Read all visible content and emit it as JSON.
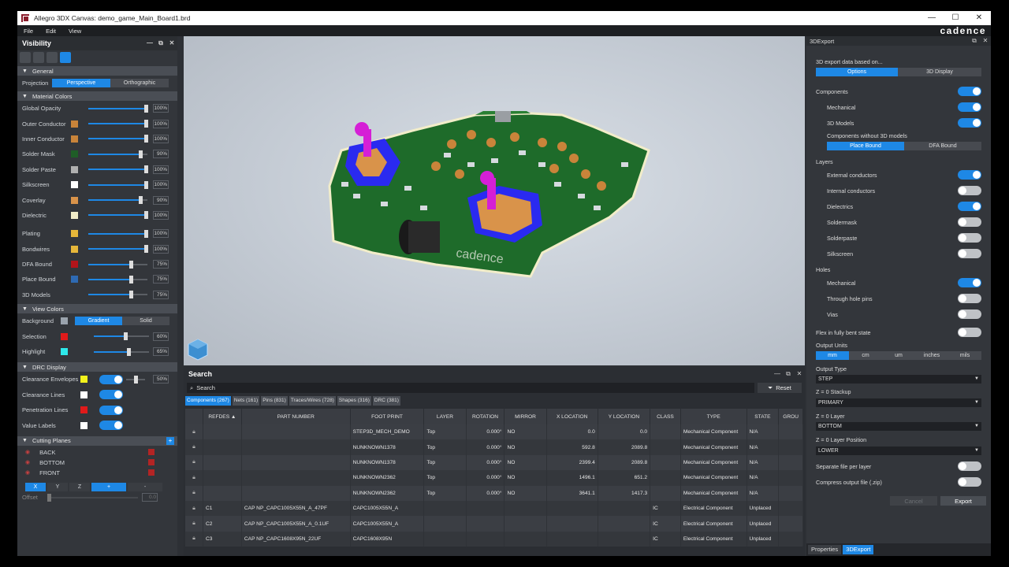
{
  "window": {
    "title": "Allegro 3DX Canvas: demo_game_Main_Board1.brd",
    "minimize": "—",
    "maximize": "☐",
    "close": "✕"
  },
  "menu": {
    "items": [
      "File",
      "Edit",
      "View"
    ],
    "logo": "cadence"
  },
  "visibility": {
    "title": "Visibility",
    "general": {
      "label": "General",
      "projection_label": "Projection",
      "projection_options": [
        "Perspective",
        "Orthographic"
      ]
    },
    "material_colors": {
      "label": "Material Colors",
      "rows": [
        {
          "name": "Global Opacity",
          "swatch": "",
          "value": "100%",
          "pct": 100
        },
        {
          "name": "Outer Conductor",
          "swatch": "#c9843a",
          "value": "100%",
          "pct": 100
        },
        {
          "name": "Inner Conductor",
          "swatch": "#c9843a",
          "value": "100%",
          "pct": 100
        },
        {
          "name": "Solder Mask",
          "swatch": "#1f5d27",
          "value": "90%",
          "pct": 90
        },
        {
          "name": "Solder Paste",
          "swatch": "#b0b0b0",
          "value": "100%",
          "pct": 100
        },
        {
          "name": "Silkscreen",
          "swatch": "#ffffff",
          "value": "100%",
          "pct": 100
        },
        {
          "name": "Coverlay",
          "swatch": "#d9934a",
          "value": "90%",
          "pct": 90
        },
        {
          "name": "Dielectric",
          "swatch": "#f2edc9",
          "value": "100%",
          "pct": 100
        },
        {
          "name": "Plating",
          "swatch": "#e6b73a",
          "value": "100%",
          "pct": 100
        },
        {
          "name": "Bondwires",
          "swatch": "#e6b73a",
          "value": "100%",
          "pct": 100
        },
        {
          "name": "DFA Bound",
          "swatch": "#b3141a",
          "value": "75%",
          "pct": 75
        },
        {
          "name": "Place Bound",
          "swatch": "#2e6ab3",
          "value": "75%",
          "pct": 75
        },
        {
          "name": "3D Models",
          "swatch": "",
          "value": "75%",
          "pct": 75
        }
      ]
    },
    "view_colors": {
      "label": "View Colors",
      "background_label": "Background",
      "background_swatch": "#9aa3ad",
      "background_options": [
        "Gradient",
        "Solid"
      ],
      "selection": {
        "name": "Selection",
        "swatch": "#e01a1a",
        "value": "60%",
        "pct": 60
      },
      "highlight": {
        "name": "Highlight",
        "swatch": "#2ee8ea",
        "value": "65%",
        "pct": 65
      }
    },
    "drc_display": {
      "label": "DRC Display",
      "rows": [
        {
          "name": "Clearance Envelopes",
          "swatch": "#f2f21c",
          "value": "50%"
        },
        {
          "name": "Clearance Lines",
          "swatch": "#ffffff"
        },
        {
          "name": "Penetration Lines",
          "swatch": "#e01a1a"
        },
        {
          "name": "Value Labels",
          "swatch": "#ffffff"
        }
      ]
    },
    "cutting_planes": {
      "label": "Cutting Planes",
      "planes": [
        "BACK",
        "BOTTOM",
        "FRONT"
      ],
      "axis_buttons": [
        "X",
        "Y",
        "Z",
        "+",
        "-"
      ],
      "offset_label": "Offset",
      "offset_value": "0.0"
    }
  },
  "search": {
    "title": "Search",
    "placeholder": "Search",
    "reset_label": "Reset",
    "filters": [
      "Components (267)",
      "Nets (161)",
      "Pins (831)",
      "Traces/Wires (728)",
      "Shapes (316)",
      "DRC (381)"
    ],
    "columns": [
      "REFDES ▲",
      "PART NUMBER",
      "FOOT PRINT",
      "LAYER",
      "ROTATION",
      "MIRROR",
      "X LOCATION",
      "Y LOCATION",
      "CLASS",
      "TYPE",
      "STATE",
      "GROU"
    ],
    "rows": [
      [
        "",
        "",
        "STEP3D_MECH_DEMO",
        "Top",
        "0.000°",
        "NO",
        "0.0",
        "0.0",
        "",
        "Mechanical Component",
        "N/A",
        ""
      ],
      [
        "",
        "",
        "NUNKNOWN1378",
        "Top",
        "0.000°",
        "NO",
        "592.8",
        "2089.8",
        "",
        "Mechanical Component",
        "N/A",
        ""
      ],
      [
        "",
        "",
        "NUNKNOWN1378",
        "Top",
        "0.000°",
        "NO",
        "2399.4",
        "2089.8",
        "",
        "Mechanical Component",
        "N/A",
        ""
      ],
      [
        "",
        "",
        "NUNKNOWN2362",
        "Top",
        "0.000°",
        "NO",
        "1496.1",
        "651.2",
        "",
        "Mechanical Component",
        "N/A",
        ""
      ],
      [
        "",
        "",
        "NUNKNOWN2362",
        "Top",
        "0.000°",
        "NO",
        "3641.1",
        "1417.3",
        "",
        "Mechanical Component",
        "N/A",
        ""
      ],
      [
        "C1",
        "CAP NP_CAPC1005X55N_A_47PF",
        "CAPC1005X55N_A",
        "",
        "",
        "",
        "",
        "",
        "IC",
        "Electrical Component",
        "Unplaced",
        ""
      ],
      [
        "C2",
        "CAP NP_CAPC1005X55N_A_0.1UF",
        "CAPC1005X55N_A",
        "",
        "",
        "",
        "",
        "",
        "IC",
        "Electrical Component",
        "Unplaced",
        ""
      ],
      [
        "C3",
        "CAP NP_CAPC1608X95N_22UF",
        "CAPC1608X95N",
        "",
        "",
        "",
        "",
        "",
        "IC",
        "Electrical Component",
        "Unplaced",
        ""
      ]
    ]
  },
  "export": {
    "title": "3DExport",
    "intro": "3D export data based on...",
    "tabs": [
      "Options",
      "3D Display"
    ],
    "components_label": "Components",
    "mechanical_label": "Mechanical",
    "models_label": "3D Models",
    "without_models_label": "Components without 3D models",
    "bound_options": [
      "Place Bound",
      "DFA Bound"
    ],
    "layers_label": "Layers",
    "layers": [
      {
        "name": "External conductors",
        "on": true
      },
      {
        "name": "Internal conductors",
        "on": false
      },
      {
        "name": "Dielectrics",
        "on": true
      },
      {
        "name": "Soldermask",
        "on": false
      },
      {
        "name": "Solderpaste",
        "on": false
      },
      {
        "name": "Silkscreen",
        "on": false
      }
    ],
    "holes_label": "Holes",
    "holes": [
      {
        "name": "Mechanical",
        "on": true
      },
      {
        "name": "Through hole pins",
        "on": false
      },
      {
        "name": "Vias",
        "on": false
      }
    ],
    "flex_label": "Flex in fully bent state",
    "units_label": "Output Units",
    "units": [
      "mm",
      "cm",
      "um",
      "inches",
      "mils"
    ],
    "type_label": "Output Type",
    "type_value": "STEP",
    "stackup_label": "Z = 0 Stackup",
    "stackup_value": "PRIMARY",
    "layer_label": "Z = 0 Layer",
    "layer_value": "BOTTOM",
    "position_label": "Z = 0 Layer Position",
    "position_value": "LOWER",
    "separate_label": "Separate file per layer",
    "compress_label": "Compress output file (.zip)",
    "cancel_label": "Cancel",
    "export_label": "Export",
    "bottom_tabs": [
      "Properties",
      "3DExport"
    ]
  },
  "colors": {
    "accent": "#1e88e5",
    "panel": "#33363b",
    "pcb": "#1e6b2a"
  }
}
